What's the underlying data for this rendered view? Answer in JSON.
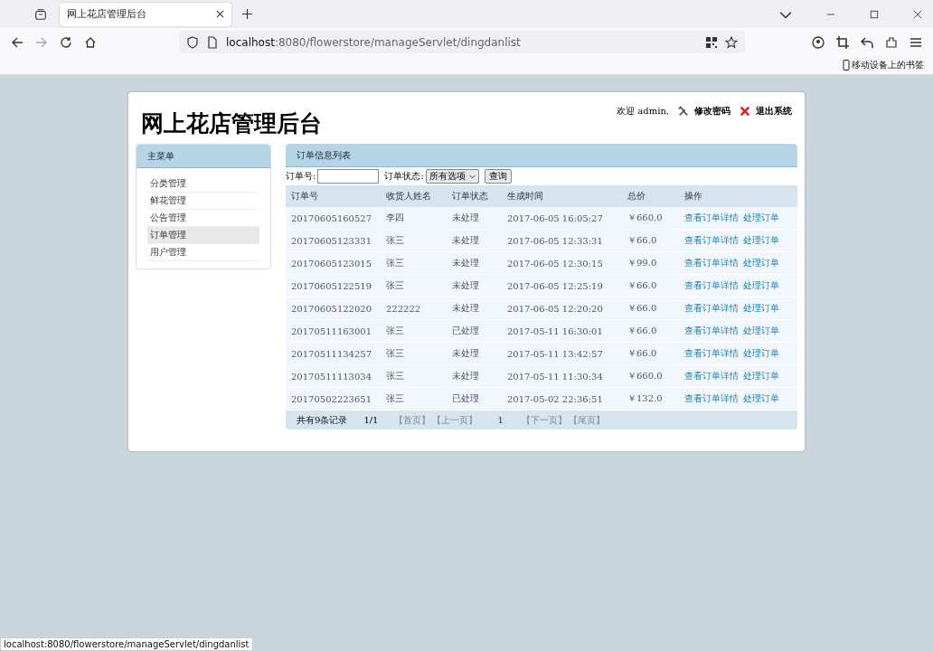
{
  "browser": {
    "tab_title": "网上花店管理后台",
    "url_host": "localhost",
    "url_rest": ":8080/flowerstore/manageServlet/dingdanlist",
    "bookmarks_label": "移动设备上的书签",
    "status_url": "localhost:8080/flowerstore/manageServlet/dingdanlist"
  },
  "header": {
    "title": "网上花店管理后台",
    "welcome": "欢迎 admin,",
    "change_password": "修改密码",
    "logout": "退出系统"
  },
  "sidebar": {
    "title": "主菜单",
    "items": [
      {
        "label": "分类管理",
        "selected": false
      },
      {
        "label": "鲜花管理",
        "selected": false
      },
      {
        "label": "公告管理",
        "selected": false
      },
      {
        "label": "订单管理",
        "selected": true
      },
      {
        "label": "用户管理",
        "selected": false
      }
    ]
  },
  "panel": {
    "title": "订单信息列表",
    "filter": {
      "order_label": "订单号:",
      "status_label": "订单状态:",
      "status_value": "所有选项",
      "search_button": "查询"
    },
    "table": {
      "columns": [
        "订单号",
        "收货人姓名",
        "订单状态",
        "生成时间",
        "总价",
        "操作"
      ],
      "rows": [
        {
          "id": "20170605160527",
          "name": "李四",
          "status": "未处理",
          "time": "2017-06-05 16:05:27",
          "total": "￥660.0",
          "actions": [
            "查看订单详情",
            "处理订单"
          ]
        },
        {
          "id": "20170605123331",
          "name": "张三",
          "status": "未处理",
          "time": "2017-06-05 12:33:31",
          "total": "￥66.0",
          "actions": [
            "查看订单详情",
            "处理订单"
          ]
        },
        {
          "id": "20170605123015",
          "name": "张三",
          "status": "未处理",
          "time": "2017-06-05 12:30:15",
          "total": "￥99.0",
          "actions": [
            "查看订单详情",
            "处理订单"
          ]
        },
        {
          "id": "20170605122519",
          "name": "张三",
          "status": "未处理",
          "time": "2017-06-05 12:25:19",
          "total": "￥66.0",
          "actions": [
            "查看订单详情",
            "处理订单"
          ]
        },
        {
          "id": "20170605122020",
          "name": "222222",
          "status": "未处理",
          "time": "2017-06-05 12:20:20",
          "total": "￥66.0",
          "actions": [
            "查看订单详情",
            "处理订单"
          ]
        },
        {
          "id": "20170511163001",
          "name": "张三",
          "status": "已处理",
          "time": "2017-05-11 16:30:01",
          "total": "￥66.0",
          "actions": [
            "查看订单详情",
            "处理订单"
          ]
        },
        {
          "id": "20170511134257",
          "name": "张三",
          "status": "未处理",
          "time": "2017-05-11 13:42:57",
          "total": "￥66.0",
          "actions": [
            "查看订单详情",
            "处理订单"
          ]
        },
        {
          "id": "20170511113034",
          "name": "张三",
          "status": "未处理",
          "time": "2017-05-11 11:30:34",
          "total": "￥660.0",
          "actions": [
            "查看订单详情",
            "处理订单"
          ]
        },
        {
          "id": "20170502223651",
          "name": "张三",
          "status": "已处理",
          "time": "2017-05-02 22:36:51",
          "total": "￥132.0",
          "actions": [
            "查看订单详情",
            "处理订单"
          ]
        }
      ]
    },
    "pager": {
      "total": "共有9条记录",
      "pages": "1/1",
      "links": [
        {
          "label": "【首页】",
          "disabled": true
        },
        {
          "label": "【上一页】",
          "disabled": true
        },
        {
          "label": "1",
          "disabled": false
        },
        {
          "label": "【下一页】",
          "disabled": true
        },
        {
          "label": "【尾页】",
          "disabled": true
        }
      ]
    }
  }
}
